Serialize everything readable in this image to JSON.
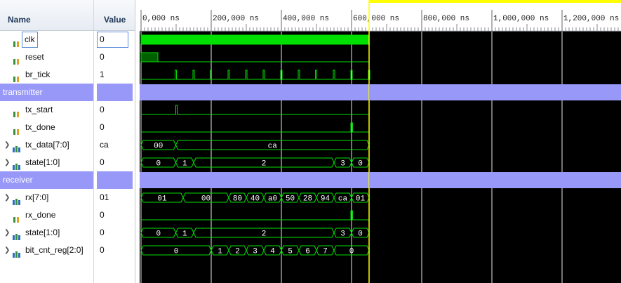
{
  "headers": {
    "name": "Name",
    "value": "Value"
  },
  "time_labels": [
    "0,000 ns",
    "200,000 ns",
    "400,000 ns",
    "600,000 ns",
    "800,000 ns",
    "1,000,000 ns",
    "1,200,000 ns"
  ],
  "signals": [
    {
      "name": "clk",
      "value": "0",
      "kind": "bit",
      "selected": true
    },
    {
      "name": "reset",
      "value": "0",
      "kind": "bit"
    },
    {
      "name": "br_tick",
      "value": "1",
      "kind": "bit"
    },
    {
      "name": "transmitter",
      "value": "",
      "kind": "group"
    },
    {
      "name": "tx_start",
      "value": "0",
      "kind": "bit"
    },
    {
      "name": "tx_done",
      "value": "0",
      "kind": "bit"
    },
    {
      "name": "tx_data[7:0]",
      "value": "ca",
      "kind": "bus"
    },
    {
      "name": "state[1:0]",
      "value": "0",
      "kind": "bus"
    },
    {
      "name": "receiver",
      "value": "",
      "kind": "group"
    },
    {
      "name": "rx[7:0]",
      "value": "01",
      "kind": "bus"
    },
    {
      "name": "rx_done",
      "value": "0",
      "kind": "bit"
    },
    {
      "name": "state[1:0]",
      "value": "0",
      "kind": "bus"
    },
    {
      "name": "bit_cnt_reg[2:0]",
      "value": "0",
      "kind": "bus"
    }
  ],
  "waves": {
    "reset": {
      "high_until_ns": 48000
    },
    "br_tick": {
      "pulses_ns": [
        97000,
        148000,
        197000,
        248000,
        298000,
        348000,
        398000,
        448000,
        497000,
        548000,
        598000,
        648000
      ]
    },
    "tx_start": {
      "pulses_ns": [
        [
          99000,
          103000
        ]
      ]
    },
    "tx_done": {
      "pulses_ns": [
        [
          598000,
          603000
        ]
      ]
    },
    "rx_done": {
      "pulses_ns": [
        [
          598000,
          603000
        ]
      ]
    },
    "tx_data": [
      [
        "00",
        0,
        99000
      ],
      [
        "ca",
        99000,
        650000
      ]
    ],
    "tx_state": [
      [
        "0",
        0,
        99000
      ],
      [
        "1",
        99000,
        150000
      ],
      [
        "2",
        150000,
        550000
      ],
      [
        "3",
        550000,
        600000
      ],
      [
        "0",
        600000,
        650000
      ]
    ],
    "rx": [
      [
        "01",
        0,
        120000
      ],
      [
        "00",
        120000,
        250000
      ],
      [
        "80",
        250000,
        300000
      ],
      [
        "40",
        300000,
        350000
      ],
      [
        "a0",
        350000,
        400000
      ],
      [
        "50",
        400000,
        450000
      ],
      [
        "28",
        450000,
        500000
      ],
      [
        "94",
        500000,
        550000
      ],
      [
        "ca",
        550000,
        600000
      ],
      [
        "01",
        600000,
        650000
      ]
    ],
    "rx_state": [
      [
        "0",
        0,
        99000
      ],
      [
        "1",
        99000,
        150000
      ],
      [
        "2",
        150000,
        550000
      ],
      [
        "3",
        550000,
        600000
      ],
      [
        "0",
        600000,
        650000
      ]
    ],
    "bit_cnt": [
      [
        "0",
        0,
        200000
      ],
      [
        "1",
        200000,
        250000
      ],
      [
        "2",
        250000,
        300000
      ],
      [
        "3",
        300000,
        350000
      ],
      [
        "4",
        350000,
        400000
      ],
      [
        "5",
        400000,
        450000
      ],
      [
        "6",
        450000,
        500000
      ],
      [
        "7",
        500000,
        550000
      ],
      [
        "0",
        550000,
        650000
      ]
    ]
  },
  "cursor_ns": 650000,
  "colors": {
    "wave": "#00e000",
    "group": "#9898f8",
    "grid": "#e8e8e8",
    "cursor": "#ffff00"
  }
}
